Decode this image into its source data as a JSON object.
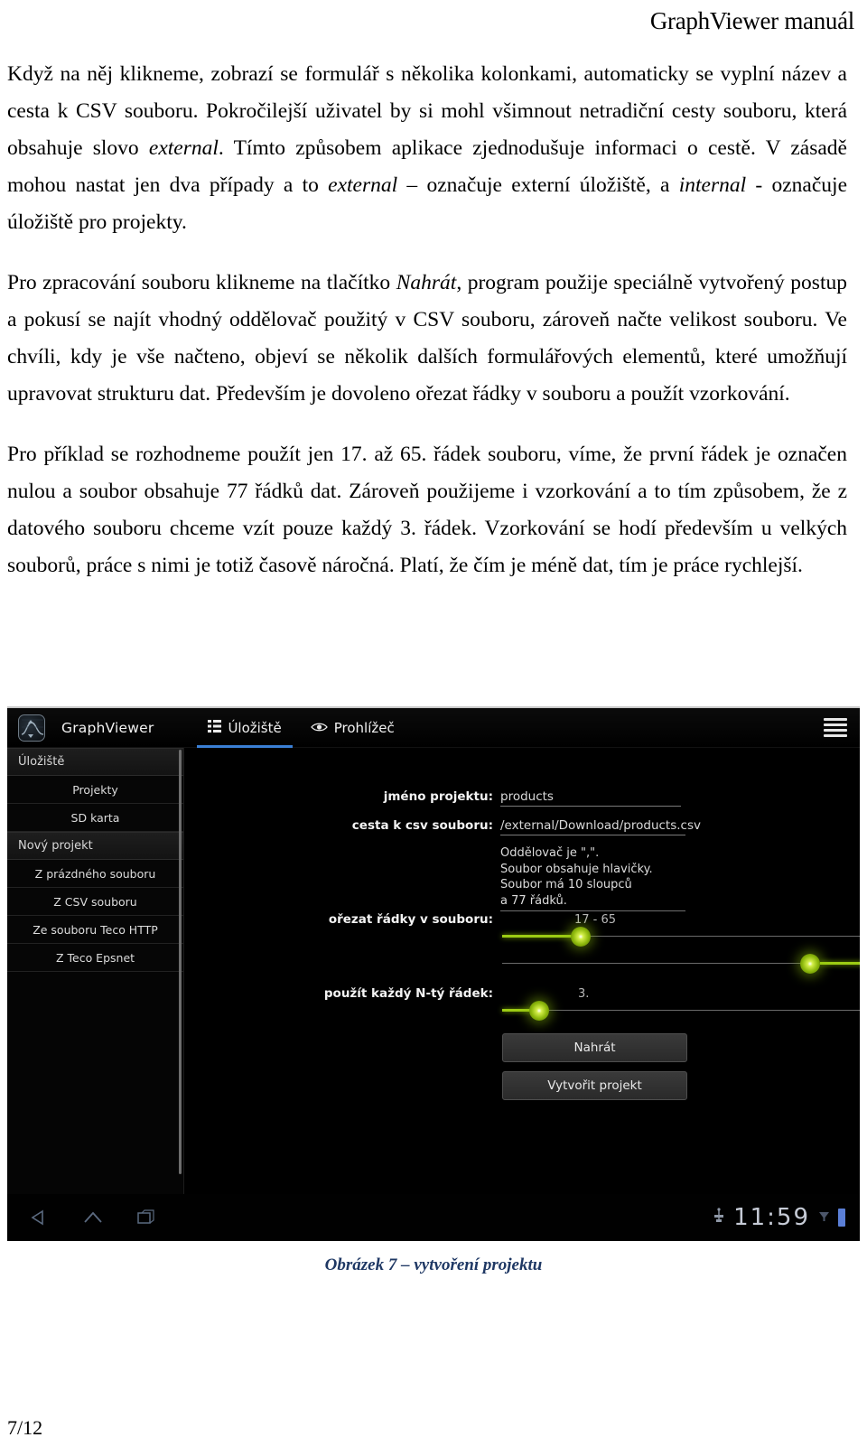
{
  "header": {
    "title": "GraphViewer manuál"
  },
  "paragraphs": [
    {
      "id": "p1",
      "runs": [
        {
          "t": "Když na něj klikneme, zobrazí se formulář s několika kolonkami, automaticky se vyplní název a cesta k CSV souboru. Pokročilejší uživatel by si mohl všimnout netradiční cesty souboru, která obsahuje slovo ",
          "i": false
        },
        {
          "t": "external",
          "i": true
        },
        {
          "t": ". Tímto způsobem aplikace zjednodušuje informaci o cestě. V zásadě mohou nastat jen dva případy a to ",
          "i": false
        },
        {
          "t": "external",
          "i": true
        },
        {
          "t": " – označuje externí úložiště, a ",
          "i": false
        },
        {
          "t": "internal",
          "i": true
        },
        {
          "t": " - označuje úložiště pro projekty.",
          "i": false
        }
      ]
    },
    {
      "id": "p2",
      "runs": [
        {
          "t": "Pro zpracování souboru klikneme na tlačítko ",
          "i": false
        },
        {
          "t": "Nahrát",
          "i": true
        },
        {
          "t": ", program použije speciálně vytvořený postup a pokusí se najít vhodný oddělovač použitý v CSV souboru, zároveň načte velikost souboru. Ve chvíli, kdy je vše načteno, objeví se několik dalších formulářových elementů, které umožňují upravovat strukturu dat. Především je dovoleno ořezat řádky v souboru a použít vzorkování.",
          "i": false
        }
      ]
    },
    {
      "id": "p3",
      "runs": [
        {
          "t": "Pro příklad se rozhodneme použít jen 17. až 65. řádek souboru, víme, že první řádek je označen nulou a soubor obsahuje 77 řádků dat. Zároveň použijeme i vzorkování a to tím způsobem, že z datového souboru chceme vzít pouze každý 3. řádek. Vzorkování se hodí především u velkých souborů, práce s nimi je totiž časově náročná. Platí, že čím je méně dat, tím je práce rychlejší.",
          "i": false
        }
      ]
    }
  ],
  "screenshot": {
    "appbar": {
      "app_title": "GraphViewer",
      "logo_icon": "graph-logo-icon",
      "menu_icon": "overflow-menu-icon",
      "tabs": [
        {
          "label": "Úložiště",
          "icon": "list-icon",
          "active": true
        },
        {
          "label": "Prohlížeč",
          "icon": "eye-icon",
          "active": false
        }
      ]
    },
    "sidebar": {
      "groups": [
        {
          "header": "Úložiště",
          "items": [
            "Projekty",
            "SD karta"
          ]
        },
        {
          "header": "Nový projekt",
          "items": [
            "Z prázdného souboru",
            "Z CSV souboru",
            "Ze souboru Teco HTTP",
            "Z Teco Epsnet"
          ]
        }
      ]
    },
    "form": {
      "project_name_label": "jméno projektu:",
      "project_name_value": "products",
      "csv_path_label": "cesta k csv souboru:",
      "csv_path_value": "/external/Download/products.csv",
      "info_lines": [
        "Oddělovač je \",\".",
        "Soubor obsahuje hlavičky.",
        "Soubor má 10 sloupců",
        "a 77 řádků."
      ],
      "trim_label": "ořezat řádky v souboru:",
      "trim_value": "17 - 65",
      "sample_label": "použít každý N-tý řádek:",
      "sample_value": "3.",
      "upload_button": "Nahrát",
      "create_button": "Vytvořit projekt"
    },
    "navbar": {
      "back_icon": "back-icon",
      "home_icon": "home-icon",
      "recents_icon": "recents-icon",
      "usb_icon": "usb-icon",
      "signal_icon": "signal-icon",
      "battery_icon": "battery-icon",
      "clock": "11:59"
    },
    "accent_color": "#9ccc14",
    "tab_highlight_color": "#3a7fd5"
  },
  "caption": "Obrázek 7 – vytvoření projektu",
  "page_number": "7/12"
}
